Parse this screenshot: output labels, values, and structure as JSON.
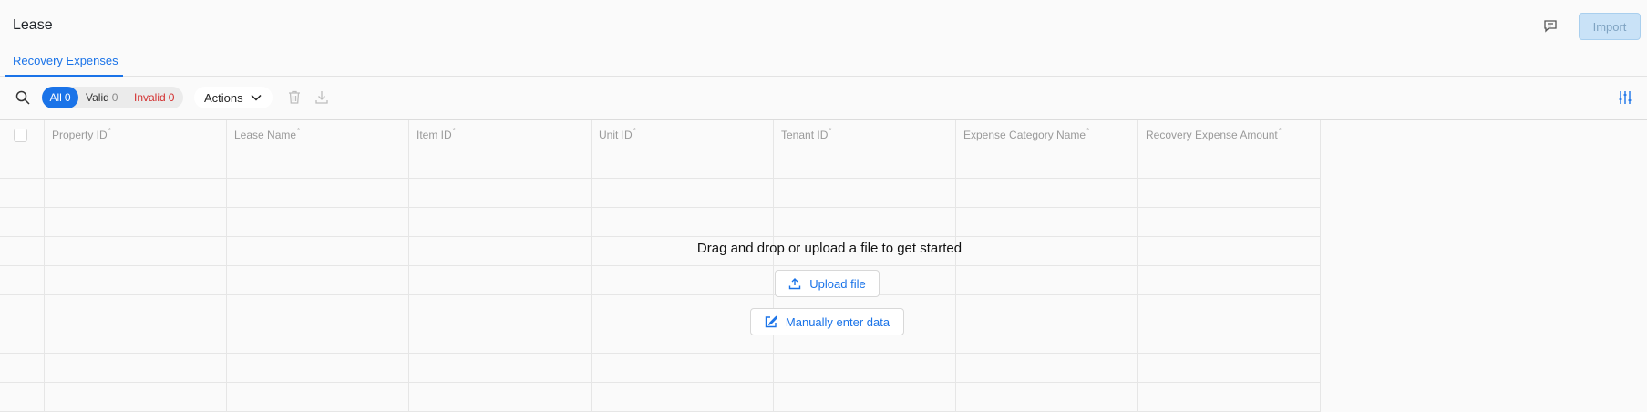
{
  "header": {
    "title": "Lease",
    "import_label": "Import",
    "feedback_icon": "message-feedback-icon"
  },
  "tabs": [
    {
      "label": "Recovery Expenses",
      "active": true
    }
  ],
  "toolbar": {
    "search_icon": "search-icon",
    "filters": {
      "all": {
        "label": "All",
        "count": "0"
      },
      "valid": {
        "label": "Valid",
        "count": "0"
      },
      "invalid": {
        "label": "Invalid",
        "count": "0"
      }
    },
    "actions_label": "Actions",
    "trash_icon": "trash-icon",
    "download_icon": "download-icon",
    "settings_icon": "sliders-icon"
  },
  "table": {
    "columns": [
      {
        "label": "Property ID",
        "required": "*"
      },
      {
        "label": "Lease Name",
        "required": "*"
      },
      {
        "label": "Item ID",
        "required": "*"
      },
      {
        "label": "Unit ID",
        "required": "*"
      },
      {
        "label": "Tenant ID",
        "required": "*"
      },
      {
        "label": "Expense Category Name",
        "required": "*"
      },
      {
        "label": "Recovery Expense Amount",
        "required": "*"
      }
    ]
  },
  "empty_state": {
    "message": "Drag and drop or upload a file to get started",
    "upload_label": "Upload file",
    "manual_label": "Manually enter data"
  },
  "colors": {
    "accent": "#1a73e8",
    "invalid": "#d32f2f",
    "import_disabled": "#c9e2f7"
  }
}
